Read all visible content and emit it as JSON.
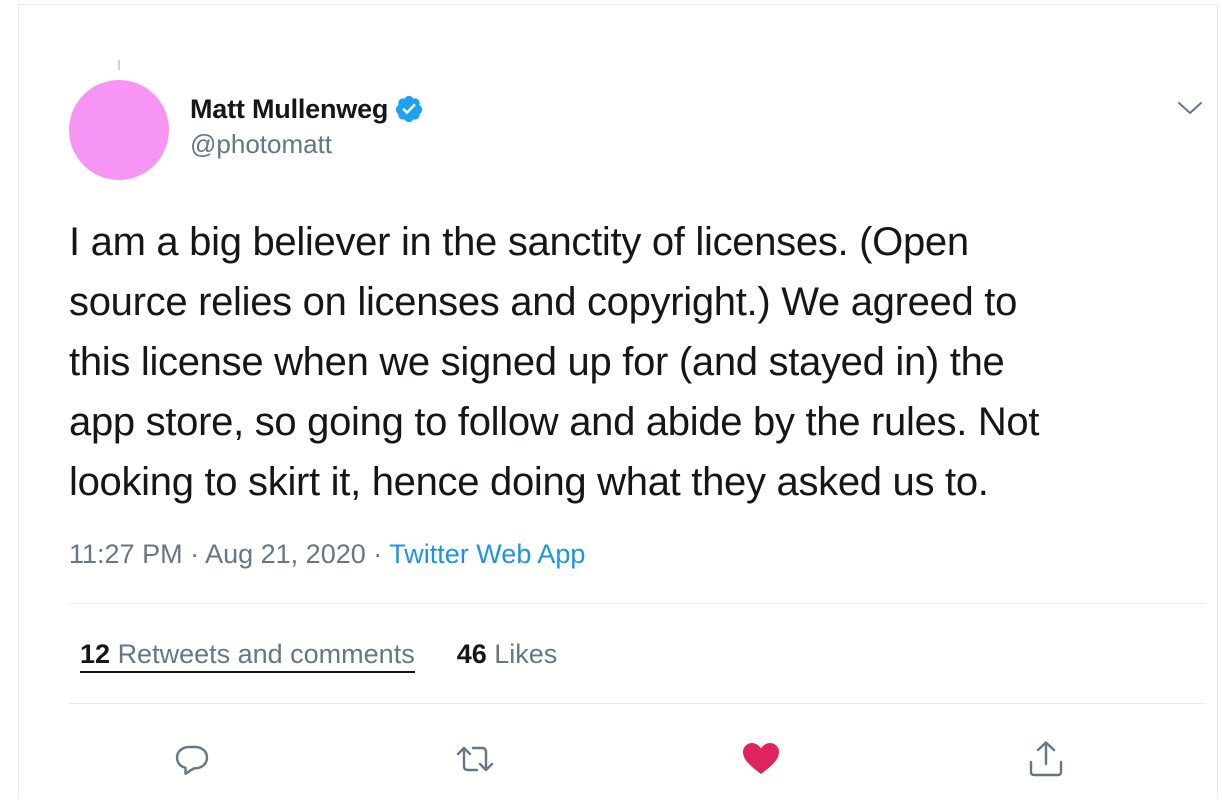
{
  "author": {
    "name": "Matt Mullenweg",
    "handle": "@photomatt",
    "verified": true,
    "avatar_color": "#f795f5"
  },
  "tweet": {
    "text": "I am a big believer in the sanctity of licenses. (Open source relies on licenses and copyright.) We agreed to this license when we signed up for (and stayed in) the app store, so going to follow and abide by the rules. Not looking to skirt it, hence doing what they asked us to.",
    "lines": [
      "I am a big believer in the sanctity of licenses. (Open",
      "source relies on licenses and copyright.) We agreed to",
      "this license when we signed up for (and stayed in) the",
      "app store, so going to follow and abide by the rules. Not",
      "looking to skirt it, hence doing what they asked us to."
    ]
  },
  "meta": {
    "time": "11:27 PM",
    "separator": "·",
    "date": "Aug 21, 2020",
    "source": "Twitter Web App"
  },
  "stats": {
    "retweets_count": "12",
    "retweets_label": "Retweets and comments",
    "likes_count": "46",
    "likes_label": "Likes"
  },
  "icons": {
    "verified": "verified-badge-icon",
    "menu": "chevron-down-icon",
    "reply": "reply-icon",
    "retweet": "retweet-icon",
    "like": "heart-icon",
    "share": "share-icon"
  },
  "colors": {
    "verified_blue": "#1da1f2",
    "link_blue": "#1b95e0",
    "like_red": "#e0245e",
    "muted_gray": "#657786"
  }
}
